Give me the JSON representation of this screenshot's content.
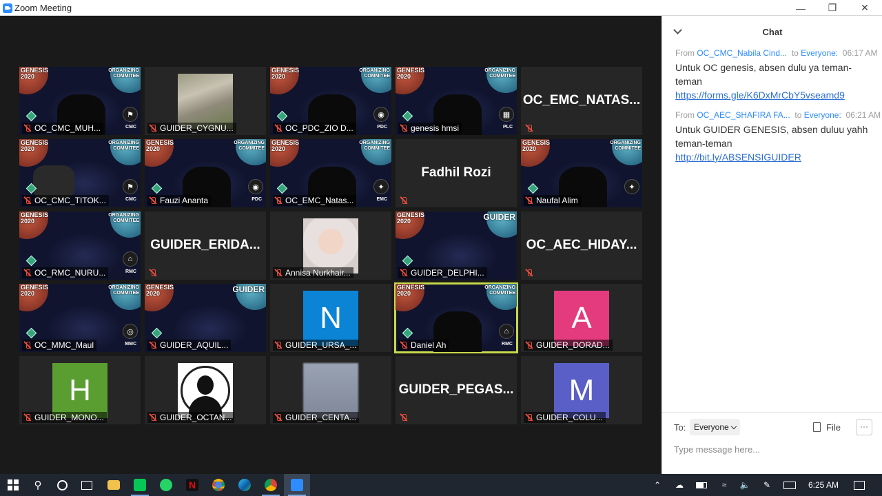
{
  "window": {
    "title": "Zoom Meeting",
    "controls": [
      "—",
      "❐",
      "✕"
    ]
  },
  "tile_brand": {
    "brand_top": "GENESIS",
    "brand_year": "2020",
    "org_line1": "ORGANIZING",
    "org_line2": "COMMITEE",
    "guider": "GUIDER"
  },
  "participants": [
    {
      "name": "OC_CMC_MUH...",
      "kind": "space",
      "badge": "CMC",
      "badge_icon": "group-icon"
    },
    {
      "name": "GUIDER_CYGNU...",
      "kind": "photo-cat"
    },
    {
      "name": "OC_PDC_ZIO D...",
      "kind": "space",
      "badge": "PDC",
      "badge_icon": "camera-icon"
    },
    {
      "name": "genesis hmsi",
      "kind": "space",
      "badge": "PLC",
      "badge_icon": "building-icon"
    },
    {
      "name": "",
      "big_name": "OC_EMC_NATAS...",
      "kind": "name-only"
    },
    {
      "name": "OC_CMC_TITOK...",
      "kind": "space",
      "badge": "CMC",
      "badge_icon": "group-icon"
    },
    {
      "name": "Fauzi Ananta",
      "kind": "space",
      "badge": "PDC",
      "badge_icon": "camera-icon"
    },
    {
      "name": "OC_EMC_Natas...",
      "kind": "space",
      "badge": "EMC",
      "badge_icon": "spark-icon"
    },
    {
      "name": "",
      "big_name": "Fadhil Rozi",
      "kind": "name-only"
    },
    {
      "name": "Naufal Alim",
      "kind": "space",
      "badge": "",
      "badge_icon": "spark-icon"
    },
    {
      "name": "OC_RMC_NURU...",
      "kind": "space",
      "badge": "RMC",
      "badge_icon": "bank-icon"
    },
    {
      "name": "",
      "big_name": "GUIDER_ERIDA...",
      "kind": "name-only"
    },
    {
      "name": "Annisa Nurkhair...",
      "kind": "photo-girl"
    },
    {
      "name": "GUIDER_DELPHI...",
      "kind": "space-guider"
    },
    {
      "name": "",
      "big_name": "OC_AEC_HIDAY...",
      "kind": "name-only"
    },
    {
      "name": "OC_MMC_Maul",
      "kind": "space",
      "badge": "MMC",
      "badge_icon": "disc-icon"
    },
    {
      "name": "GUIDER_AQUIL...",
      "kind": "space-guider"
    },
    {
      "name": "GUIDER_URSA_...",
      "kind": "avatar",
      "letter": "N",
      "color": "#0b84d6"
    },
    {
      "name": "Daniel Ah",
      "kind": "space",
      "badge": "RMC",
      "badge_icon": "bank-icon",
      "active": true
    },
    {
      "name": "GUIDER_DORAD...",
      "kind": "avatar",
      "letter": "A",
      "color": "#e43b7e"
    },
    {
      "name": "GUIDER_MONO...",
      "kind": "avatar",
      "letter": "H",
      "color": "#5a9e32"
    },
    {
      "name": "GUIDER_OCTAN...",
      "kind": "photo-silhouette"
    },
    {
      "name": "GUIDER_CENTA...",
      "kind": "photo-blur"
    },
    {
      "name": "",
      "big_name": "GUIDER_PEGAS...",
      "kind": "name-only"
    },
    {
      "name": "GUIDER_COLU...",
      "kind": "avatar",
      "letter": "M",
      "color": "#5a5fc8"
    }
  ],
  "chat": {
    "title": "Chat",
    "messages": [
      {
        "from_label": "From",
        "sender": "OC_CMC_Nabila Cind...",
        "to_label": "to",
        "recipient": "Everyone:",
        "time": "06:17 AM",
        "text": "Untuk OC genesis, absen dulu ya teman-teman",
        "link": "https://forms.gle/K6DxMrCbY5vseamd9"
      },
      {
        "from_label": "From",
        "sender": "OC_AEC_SHAFIRA FA...",
        "to_label": "to",
        "recipient": "Everyone:",
        "time": "06:21 AM",
        "text": "Untuk GUIDER GENESIS, absen duluu yahh teman-teman",
        "link": "http://bit.ly/ABSENSIGUIDER"
      }
    ],
    "to_label": "To:",
    "to_value": "Everyone",
    "file_label": "File",
    "more_label": "···",
    "input_placeholder": "Type message here..."
  },
  "taskbar": {
    "clock": "6:25 AM",
    "apps": [
      "start",
      "search",
      "cortana",
      "task-view",
      "file-explorer",
      "line",
      "whatsapp",
      "netflix",
      "chrome",
      "edge",
      "chrome-2",
      "zoom"
    ],
    "colors": {
      "line": "#06c755",
      "whatsapp": "#25d366",
      "netflix": "#e50914",
      "zoom": "#2d8cff",
      "explorer": "#f2c14e"
    }
  }
}
